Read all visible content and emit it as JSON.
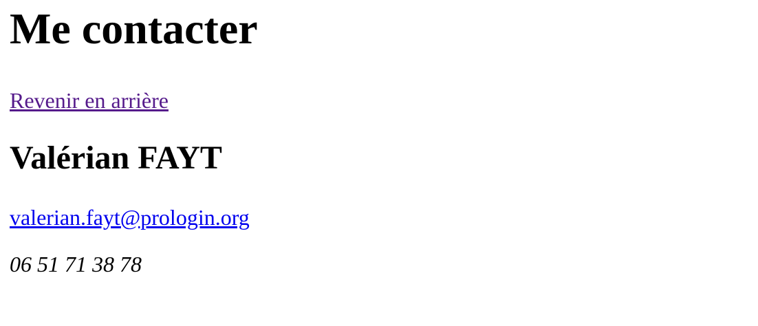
{
  "page": {
    "title": "Me contacter",
    "back_link": "Revenir en arrière",
    "contact_name": "Valérian FAYT",
    "email": "valerian.fayt@prologin.org",
    "phone": "06 51 71 38 78"
  },
  "colors": {
    "visited_link": "#551a8b",
    "link": "#0000ee",
    "text": "#000000",
    "background": "#ffffff"
  }
}
